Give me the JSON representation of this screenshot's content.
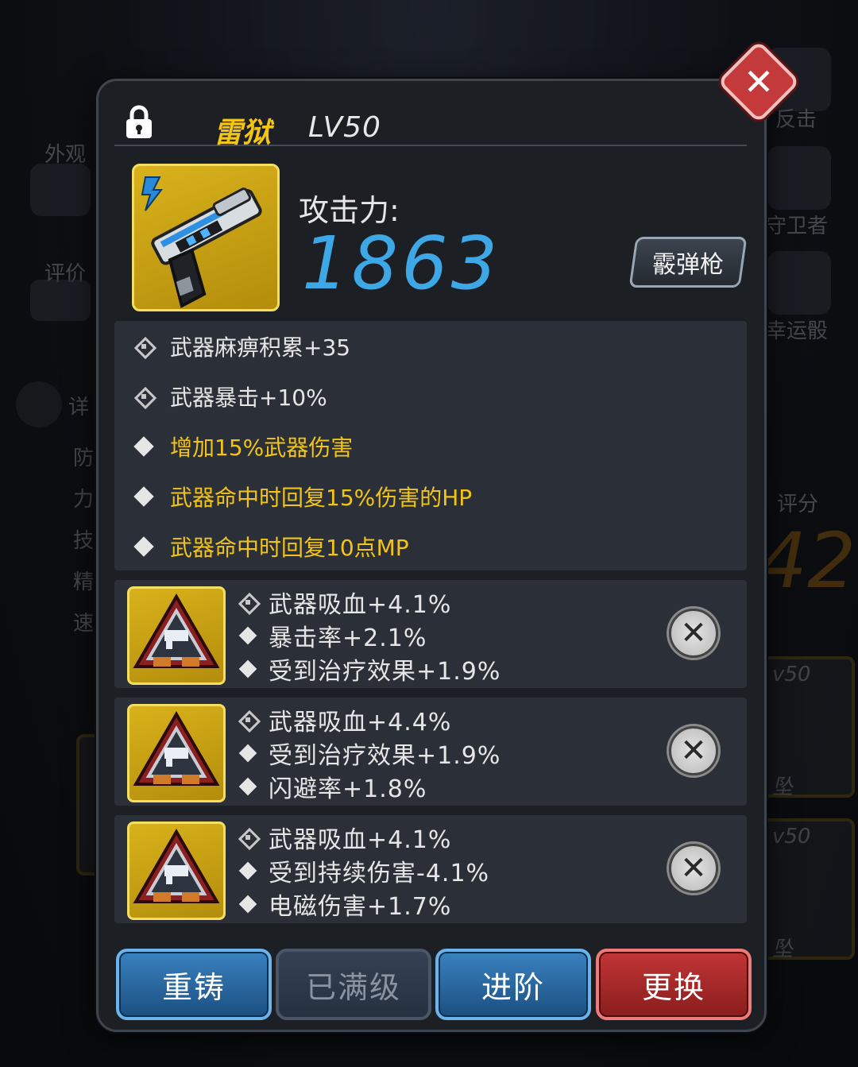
{
  "background": {
    "left_labels": [
      "外观",
      "评价",
      "详",
      "防",
      "力",
      "技",
      "精",
      "速"
    ],
    "right_labels": [
      "反击",
      "守卫者",
      "幸运骰",
      "评分"
    ],
    "score_partial": "42",
    "card_levels": [
      "v50",
      "v50"
    ],
    "card_names": [
      "坠",
      "坠"
    ]
  },
  "header": {
    "weapon_name": "雷狱",
    "level": "LV50"
  },
  "weapon": {
    "attack_label": "攻击力:",
    "attack_value": "1863",
    "type_badge": "霰弹枪",
    "element_icon": "lightning-icon"
  },
  "stats": [
    {
      "text": "武器麻痹积累+35",
      "icon": "gem-icon",
      "color": "white"
    },
    {
      "text": "武器暴击+10%",
      "icon": "gem-icon",
      "color": "white"
    },
    {
      "text": "增加15%武器伤害",
      "icon": "diamond-icon",
      "color": "yellow"
    },
    {
      "text": "武器命中时回复15%伤害的HP",
      "icon": "diamond-icon",
      "color": "yellow"
    },
    {
      "text": "武器命中时回复10点MP",
      "icon": "diamond-icon",
      "color": "yellow"
    }
  ],
  "chips": [
    {
      "lines": [
        "武器吸血+4.1%",
        "暴击率+2.1%",
        "受到治疗效果+1.9%"
      ]
    },
    {
      "lines": [
        "武器吸血+4.4%",
        "受到治疗效果+1.9%",
        "闪避率+1.8%"
      ]
    },
    {
      "lines": [
        "武器吸血+4.1%",
        "受到持续伤害-4.1%",
        "电磁伤害+1.7%"
      ]
    }
  ],
  "buttons": {
    "reforge": "重铸",
    "maxed": "已满级",
    "advance": "进阶",
    "replace": "更换"
  },
  "colors": {
    "accent_yellow": "#f2c418",
    "attack_blue": "#3ea7e6",
    "button_blue": "#2a6aa5",
    "button_red": "#b02a2a"
  }
}
